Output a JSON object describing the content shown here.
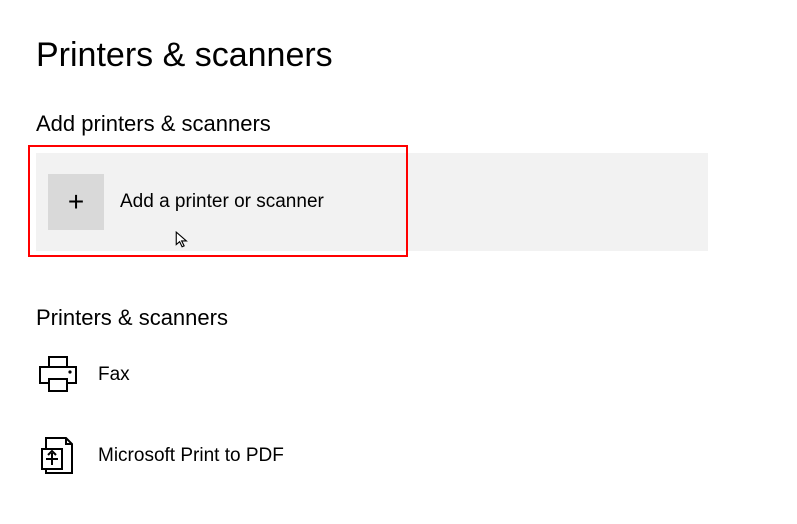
{
  "page": {
    "title": "Printers & scanners"
  },
  "sections": {
    "add": {
      "title": "Add printers & scanners",
      "action_label": "Add a printer or scanner"
    },
    "list": {
      "title": "Printers & scanners",
      "devices": [
        {
          "name": "Fax",
          "icon": "fax-icon"
        },
        {
          "name": "Microsoft Print to PDF",
          "icon": "print-to-pdf-icon"
        }
      ]
    }
  },
  "annotation": {
    "highlight_target": "add-printer-button"
  }
}
